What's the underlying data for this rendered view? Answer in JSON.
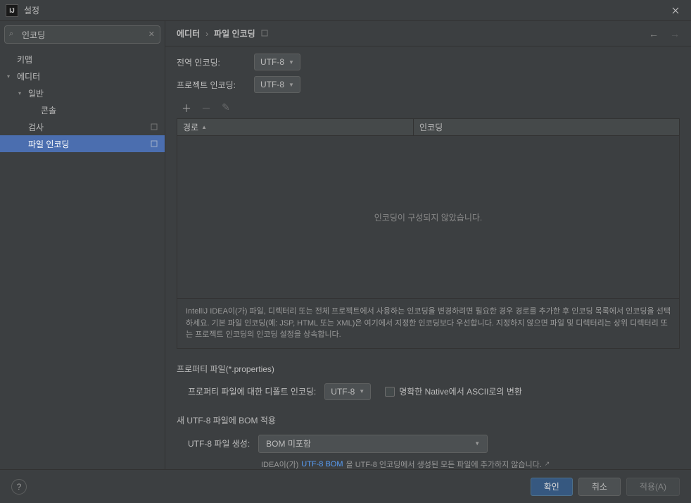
{
  "window": {
    "title": "설정"
  },
  "search": {
    "value": "인코딩",
    "placeholder": ""
  },
  "tree": {
    "keymap": "키맵",
    "editor": "에디터",
    "general": "일반",
    "console": "콘솔",
    "inspections": "검사",
    "fileencodings": "파일 인코딩"
  },
  "breadcrumb": {
    "editor": "에디터",
    "fileencodings": "파일 인코딩"
  },
  "globalEncoding": {
    "label": "전역 인코딩:",
    "value": "UTF-8"
  },
  "projectEncoding": {
    "label": "프로젝트 인코딩:",
    "value": "UTF-8"
  },
  "table": {
    "col_path": "경로",
    "col_encoding": "인코딩",
    "empty": "인코딩이 구성되지 않았습니다."
  },
  "info": "IntelliJ IDEA이(가) 파일, 디렉터리 또는 전체 프로젝트에서 사용하는 인코딩을 변경하려면 필요한 경우 경로를 추가한 후 인코딩 목록에서 인코딩을 선택하세요. 기본 파일 인코딩(예: JSP, HTML 또는 XML)은 여기에서 지정한 인코딩보다 우선합니다. 지정하지 않으면 파일 및 디렉터리는 상위 디렉터리 또는 프로젝트 인코딩의 인코딩 설정을 상속합니다.",
  "properties": {
    "title": "프로퍼티 파일(*.properties)",
    "defaultLabel": "프로퍼티 파일에 대한 디폴트 인코딩:",
    "defaultValue": "UTF-8",
    "asciiLabel": "명확한 Native에서 ASCII로의 변환"
  },
  "bom": {
    "title": "새 UTF-8 파일에 BOM 적용",
    "label": "UTF-8 파일 생성:",
    "value": "BOM 미포함",
    "help_prefix": "IDEA이(가) ",
    "help_link": "UTF-8 BOM",
    "help_suffix": "을 UTF-8 인코딩에서 생성된 모든 파일에 추가하지 않습니다."
  },
  "footer": {
    "ok": "확인",
    "cancel": "취소",
    "apply": "적용(A)"
  }
}
